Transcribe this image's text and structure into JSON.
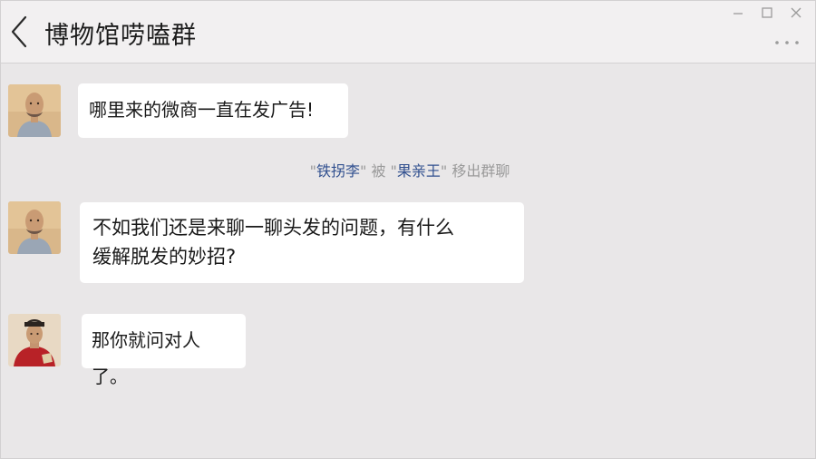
{
  "header": {
    "title": "博物馆唠嗑群"
  },
  "messages": [
    {
      "sender": "user1",
      "text": "哪里来的微商一直在发广告!"
    },
    {
      "sender": "user1",
      "text_line1": "不如我们还是来聊一聊头发的问题，有什么",
      "text_line2": "缓解脱发的妙招?"
    },
    {
      "sender": "user2",
      "text": "那你就问对人了。"
    }
  ],
  "system": {
    "quote_open1": "\"",
    "name1": "铁拐李",
    "quote_close1": "\"",
    "verb": " 被 ",
    "quote_open2": "\"",
    "name2": "果亲王",
    "quote_close2": "\"",
    "action": " 移出群聊"
  },
  "colors": {
    "background": "#e9e7e8",
    "header": "#f2f0f1",
    "bubble": "#ffffff",
    "link_name": "#31508f"
  }
}
